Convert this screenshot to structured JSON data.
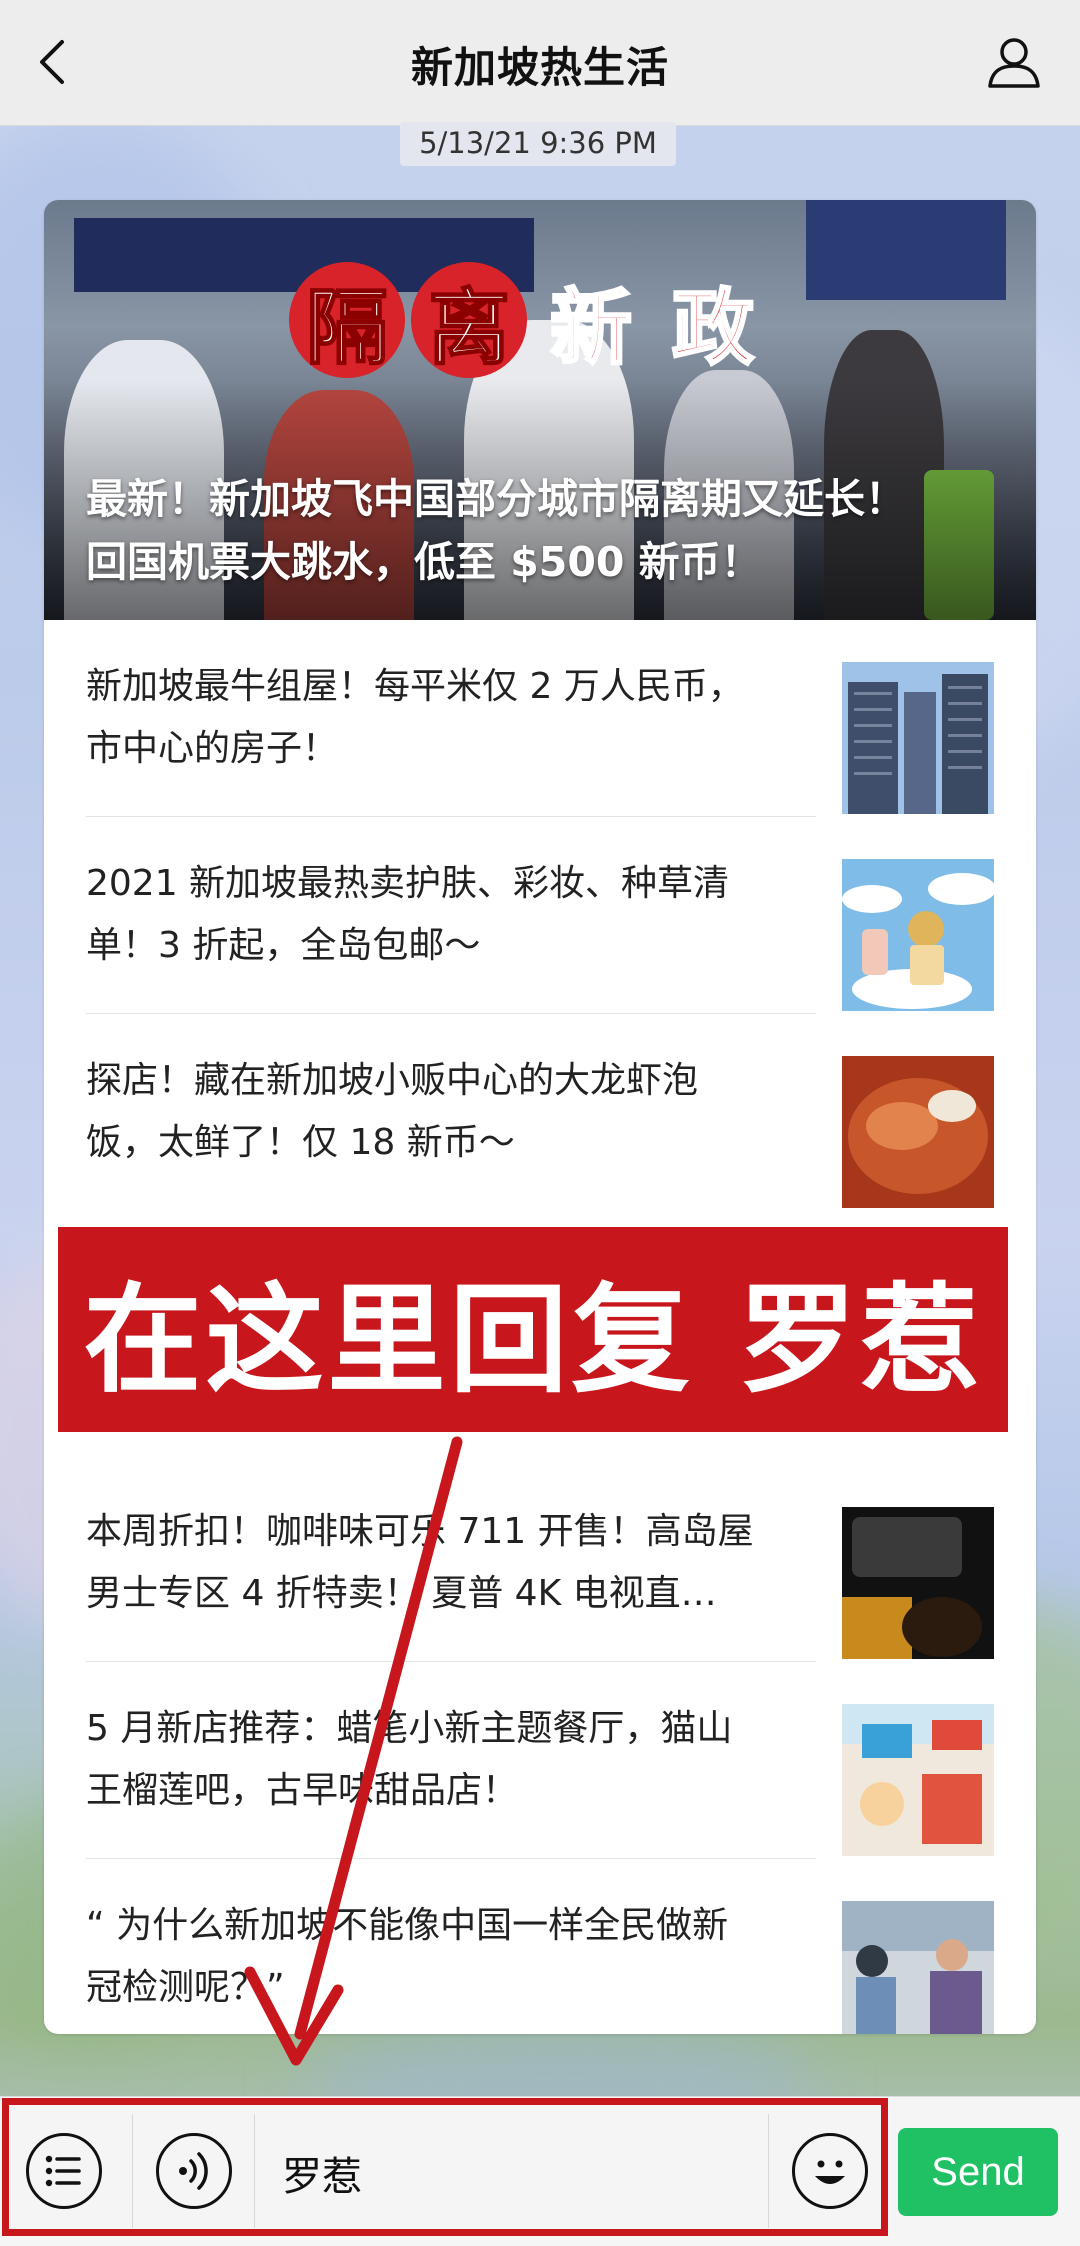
{
  "header": {
    "title": "新加坡热生活"
  },
  "message": {
    "timestamp": "5/13/21 9:36 PM",
    "hero": {
      "stamp_chars": [
        "隔",
        "离",
        "新",
        "政"
      ],
      "headline_line1": "最新！新加坡飞中国部分城市隔离期又延长！",
      "headline_line2": "回国机票大跳水，低至 $500 新币！"
    },
    "articles": [
      {
        "line1": "新加坡最牛组屋！每平米仅 2 万人民币，",
        "line2": "市中心的房子！",
        "thumb": "high-rise-buildings-photo"
      },
      {
        "line1": "2021 新加坡最热卖护肤、彩妆、种草清",
        "line2": "单！3 折起，全岛包邮～",
        "thumb": "sky-cosmetics-photo"
      },
      {
        "line1": "探店！藏在新加坡小贩中心的大龙虾泡",
        "line2": "饭，太鲜了！仅 18 新币～",
        "thumb": "lobster-rice-photo"
      },
      {
        "line1": "本周折扣！咖啡味可乐 711 开售！高岛屋",
        "line2": "男士专区 4 折特卖！ 夏普 4K 电视直…",
        "thumb": "cola-can-photo"
      },
      {
        "line1": "5 月新店推荐：蜡笔小新主题餐厅，猫山",
        "line2": "王榴莲吧，古早味甜品店！",
        "thumb": "crayon-shinchan-restaurant-photo"
      },
      {
        "line1": "“ 为什么新加坡不能像中国一样全民做新",
        "line2": "冠检测呢？”",
        "thumb": "covid-testing-photo"
      }
    ]
  },
  "overlay": {
    "banner_text": "在这里回复 罗惹",
    "arrow_color": "#c8161d"
  },
  "input_bar": {
    "value": "罗惹",
    "send_label": "Send",
    "icons": [
      "menu-list-icon",
      "voice-icon",
      "emoji-icon"
    ]
  },
  "colors": {
    "accent_red": "#c8161d",
    "send_green": "#20c165"
  }
}
